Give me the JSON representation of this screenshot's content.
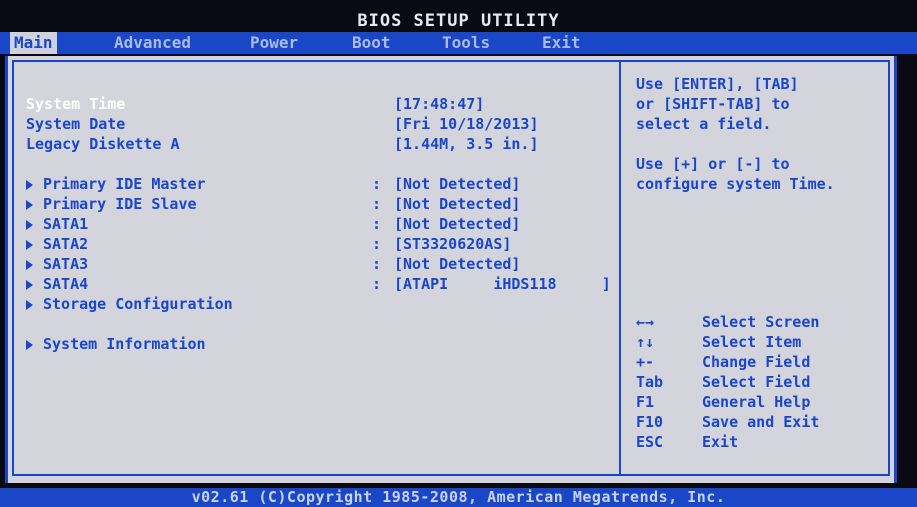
{
  "title": "BIOS SETUP UTILITY",
  "menu": [
    {
      "label": "Main",
      "active": true
    },
    {
      "label": "Advanced"
    },
    {
      "label": "Power"
    },
    {
      "label": "Boot"
    },
    {
      "label": "Tools"
    },
    {
      "label": "Exit"
    }
  ],
  "settings": {
    "system_time": {
      "label": "System Time",
      "value": "[17:48:47]"
    },
    "system_date": {
      "label": "System Date",
      "value": "[Fri 10/18/2013]"
    },
    "legacy_diskette": {
      "label": "Legacy Diskette A",
      "value": "[1.44M, 3.5 in.]"
    }
  },
  "devices": [
    {
      "label": "Primary IDE Master",
      "value": "[Not Detected]"
    },
    {
      "label": "Primary IDE Slave",
      "value": "[Not Detected]"
    },
    {
      "label": "SATA1",
      "value": "[Not Detected]"
    },
    {
      "label": "SATA2",
      "value": "[ST3320620AS]"
    },
    {
      "label": "SATA3",
      "value": "[Not Detected]"
    },
    {
      "label": "SATA4",
      "value": "[ATAPI     iHDS118     ]"
    }
  ],
  "submenus": {
    "storage": "Storage Configuration",
    "system_info": "System Information"
  },
  "colon": ":",
  "help": {
    "line1": "Use [ENTER], [TAB]",
    "line2": "or [SHIFT-TAB] to",
    "line3": "select a field.",
    "line4": "Use [+] or [-] to",
    "line5": "configure system Time."
  },
  "keys": [
    {
      "key": "←→",
      "desc": "Select Screen"
    },
    {
      "key": "↑↓",
      "desc": "Select Item"
    },
    {
      "key": "+-",
      "desc": "Change Field"
    },
    {
      "key": "Tab",
      "desc": "Select Field"
    },
    {
      "key": "F1",
      "desc": "General Help"
    },
    {
      "key": "F10",
      "desc": "Save and Exit"
    },
    {
      "key": "ESC",
      "desc": "Exit"
    }
  ],
  "footer": "v02.61 (C)Copyright 1985-2008, American Megatrends, Inc.",
  "colors": {
    "bios_blue": "#1a47c8",
    "panel_gray": "#d3d4dc",
    "selected_text": "#ffffff"
  }
}
